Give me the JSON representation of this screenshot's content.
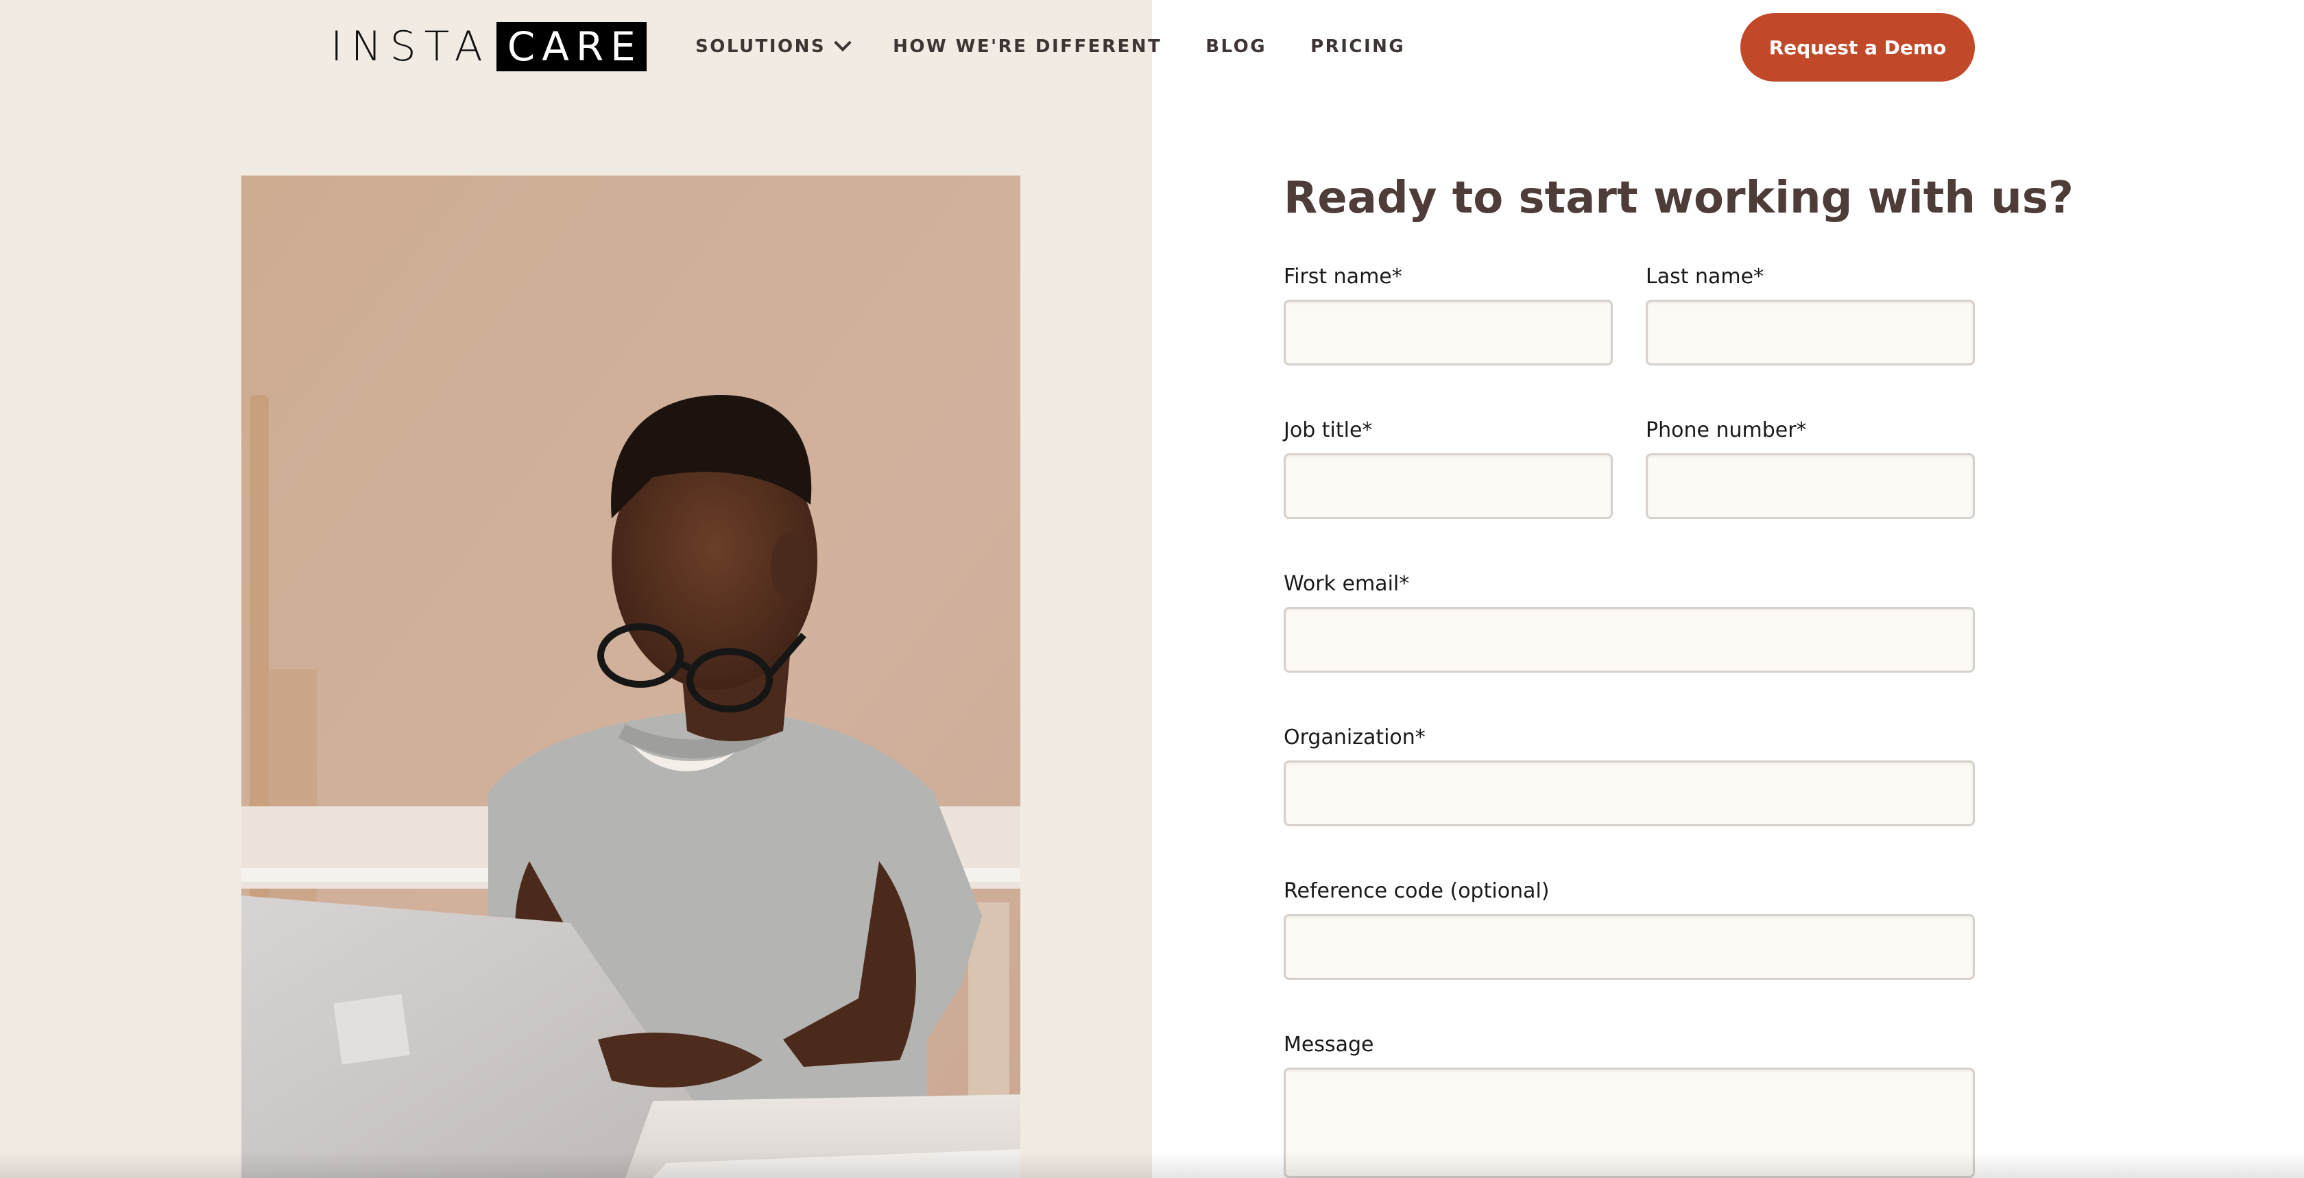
{
  "brand": {
    "logo_left": "INSTA",
    "logo_right": "CARE"
  },
  "nav": {
    "items": [
      {
        "label": "SOLUTIONS",
        "has_dropdown": true
      },
      {
        "label": "HOW WE'RE DIFFERENT"
      },
      {
        "label": "BLOG"
      },
      {
        "label": "PRICING"
      }
    ],
    "cta_label": "Request a Demo"
  },
  "colors": {
    "accent": "#c2482a",
    "left_background": "#f2ebe4",
    "heading": "#4e3c39",
    "input_background": "#fdf9f5"
  },
  "form": {
    "title": "Ready to start working with us?",
    "fields": {
      "first_name": {
        "label": "First name*",
        "value": ""
      },
      "last_name": {
        "label": "Last name*",
        "value": ""
      },
      "job_title": {
        "label": "Job title*",
        "value": ""
      },
      "phone_number": {
        "label": "Phone number*",
        "value": ""
      },
      "work_email": {
        "label": "Work email*",
        "value": ""
      },
      "organization": {
        "label": "Organization*",
        "value": ""
      },
      "reference_code": {
        "label": "Reference code (optional)",
        "value": ""
      },
      "message": {
        "label": "Message",
        "value": ""
      }
    }
  },
  "hero_image": {
    "icon": "person-using-laptop-photo"
  }
}
